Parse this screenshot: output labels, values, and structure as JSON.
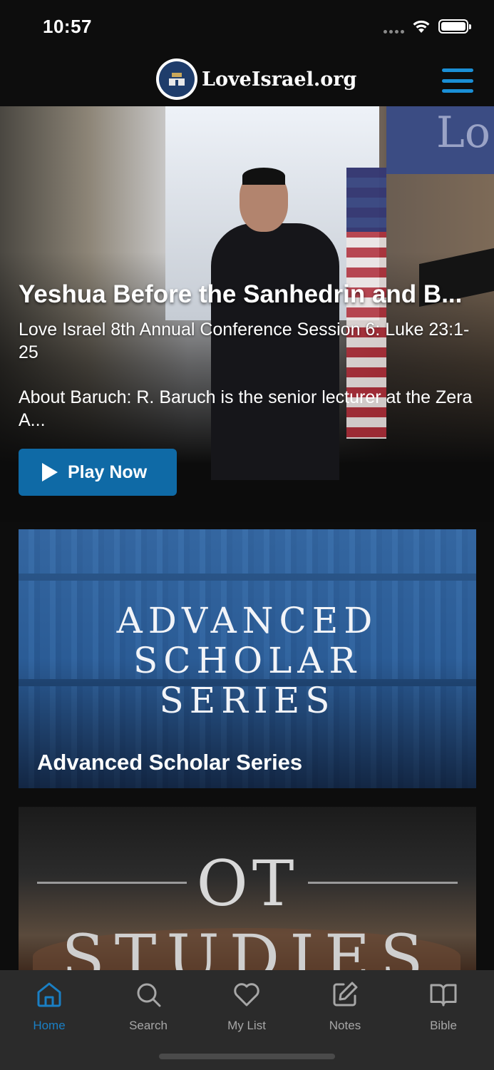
{
  "status_bar": {
    "time": "10:57"
  },
  "header": {
    "logo_text": "LoveIsrael.org",
    "logo_badge_text": "LoveIsrael.org"
  },
  "hero": {
    "title": "Yeshua Before the Sanhedrin and B...",
    "subtitle": "Love Israel 8th Annual Conference Session 6:  Luke 23:1-25",
    "about": "About Baruch:  R. Baruch is the senior lecturer at the Zera A...",
    "play_label": "Play Now"
  },
  "cards": [
    {
      "label": "Advanced Scholar Series",
      "art_lines": [
        "ADVANCED",
        "SCHOLAR",
        "SERIES"
      ]
    },
    {
      "label": "",
      "art_lines": [
        "OT",
        "STUDIES"
      ]
    }
  ],
  "tabs": [
    {
      "label": "Home",
      "icon": "home-icon",
      "active": true
    },
    {
      "label": "Search",
      "icon": "search-icon",
      "active": false
    },
    {
      "label": "My List",
      "icon": "heart-icon",
      "active": false
    },
    {
      "label": "Notes",
      "icon": "edit-icon",
      "active": false
    },
    {
      "label": "Bible",
      "icon": "book-icon",
      "active": false
    }
  ],
  "colors": {
    "accent": "#1a7fc4",
    "play_button": "#0f6aa6",
    "tab_bar": "#2b2b2b",
    "background": "#0d0d0d"
  }
}
